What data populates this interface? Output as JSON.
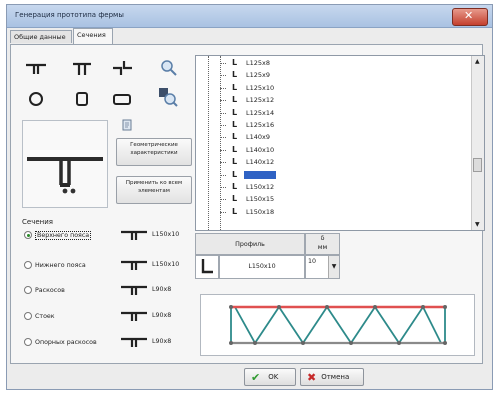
{
  "window": {
    "title": "Генерация прототипа фермы"
  },
  "tabs": [
    {
      "label": "Общие данные"
    },
    {
      "label": "Сечения"
    }
  ],
  "buttons": {
    "geom_chars": "Геометрические характеристики",
    "apply_all": "Применить ко всем элементам",
    "ok": "OK",
    "cancel": "Отмена"
  },
  "sections_list": {
    "items": [
      "L125x8",
      "L125x9",
      "L125x10",
      "L125x12",
      "L125x14",
      "L125x16",
      "L140x9",
      "L140x10",
      "L140x12",
      "L150x10",
      "L150x12",
      "L150x15",
      "L150x18"
    ],
    "selected": "L150x10"
  },
  "sections_group": {
    "label": "Сечения",
    "items": [
      {
        "label": "Верхнего пояса",
        "value": "L150x10",
        "selected": true
      },
      {
        "label": "Нижнего пояса",
        "value": "L150x10",
        "selected": false
      },
      {
        "label": "Раскосов",
        "value": "L90x8",
        "selected": false
      },
      {
        "label": "Стоек",
        "value": "L90x8",
        "selected": false
      },
      {
        "label": "Опорных раскосов",
        "value": "L90x8",
        "selected": false
      }
    ]
  },
  "profile_table": {
    "col_profile": "Профиль",
    "col_delta": "δ",
    "col_unit": "мм",
    "profile_value": "L150x10",
    "delta_value": "10"
  },
  "colors": {
    "selection": "#2f62c4",
    "ok_check": "#2e9a2e",
    "cancel_x": "#c62a2a",
    "truss_chord": "#e05050",
    "truss_web": "#2d8a8a"
  }
}
